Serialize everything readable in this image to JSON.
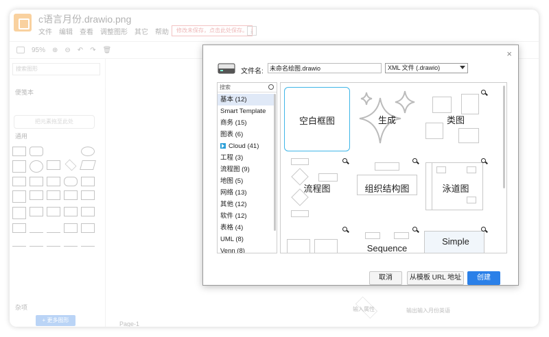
{
  "app": {
    "title": "c语言月份.drawio.png",
    "menu": [
      "文件",
      "编辑",
      "查看",
      "调整图形",
      "其它",
      "帮助"
    ],
    "save_warning": "修改未保存，点击此处保存。",
    "zoom": "95%",
    "search_placeholder": "搜索图形",
    "sidebar_sections": [
      "便笺本",
      "通用",
      "杂项"
    ],
    "scratch_hint": "把元素拖至此处",
    "more_shapes": "+ 更多图形",
    "page_tab": "Page-1",
    "canvas_labels": [
      "输入属性",
      "输出输入月份英语"
    ]
  },
  "dialog": {
    "filename_label": "文件名:",
    "filename_value": "未命名绘图.drawio",
    "format_selected": "XML 文件 (.drawio)",
    "category_search_placeholder": "搜索",
    "categories": [
      {
        "label": "基本 (12)",
        "selected": true
      },
      {
        "label": "Smart Template"
      },
      {
        "label": "商务 (15)"
      },
      {
        "label": "图表 (6)"
      },
      {
        "label": "Cloud (41)",
        "icon": "cloud-icon"
      },
      {
        "label": "工程 (3)"
      },
      {
        "label": "流程图 (9)"
      },
      {
        "label": "地图 (5)"
      },
      {
        "label": "网络 (13)"
      },
      {
        "label": "其他 (12)"
      },
      {
        "label": "软件 (12)"
      },
      {
        "label": "表格 (4)"
      },
      {
        "label": "UML (8)"
      },
      {
        "label": "Venn (8)"
      }
    ],
    "templates": [
      {
        "label": "空白框图",
        "selected": true
      },
      {
        "label": "生成"
      },
      {
        "label": "类图"
      },
      {
        "label": "流程图"
      },
      {
        "label": "组织结构图"
      },
      {
        "label": "泳道图"
      },
      {
        "label": ""
      },
      {
        "label": "Sequence"
      },
      {
        "label": "Simple"
      }
    ],
    "buttons": {
      "cancel": "取消",
      "from_url": "从模板 URL 地址",
      "create": "创建"
    },
    "close_label": "×"
  },
  "colors": {
    "accent": "#2b80e8",
    "selected_template_border": "#3db5e7",
    "selected_category": "#e0e9f7"
  }
}
